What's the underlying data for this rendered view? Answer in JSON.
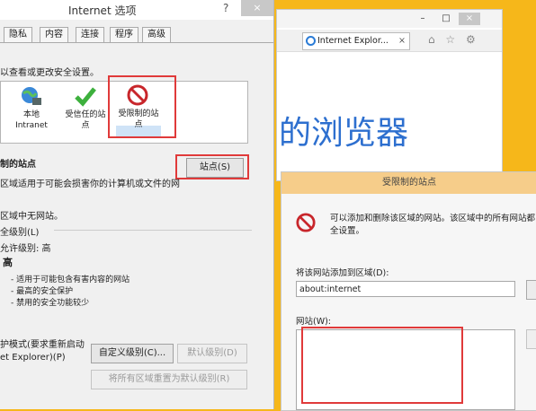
{
  "browser": {
    "tab_title": "Internet Explor...",
    "tab_close": "×",
    "minimize": "–",
    "maximize": "□",
    "close": "×",
    "nav_icons": "⌂ ☆ ⚙",
    "heading": "的浏览器"
  },
  "options_dialog": {
    "title": "Internet 选项",
    "help": "?",
    "close": "×",
    "tabs": [
      "隐私",
      "内容",
      "连接",
      "程序",
      "高级"
    ],
    "zones_desc": "以查看或更改安全设置。",
    "zones": [
      {
        "label_line1": "本地",
        "label_line2": "Intranet"
      },
      {
        "label_line1": "受信任的站",
        "label_line2": "点"
      },
      {
        "label_line1": "受限制的站",
        "label_line2": "点"
      }
    ],
    "restricted_title": "制的站点",
    "sites_button": "站点(S)",
    "restricted_desc": "区域适用于可能会损害你的计算机或文件的网",
    "no_sites": "区域中无网站。",
    "security_level_title": "全级别(L)",
    "allowed_level": "允许级别: 高",
    "level_name": "高",
    "bullets": [
      "- 适用于可能包含有害内容的网站",
      "- 最高的安全保护",
      "- 禁用的安全功能较少"
    ],
    "protect_mode_line1": "护模式(要求重新启动",
    "protect_mode_line2": "et Explorer)(P)",
    "custom_level_button": "自定义级别(C)...",
    "default_level_button": "默认级别(D)",
    "reset_all_button": "将所有区域重置为默认级别(R)"
  },
  "restricted_dialog": {
    "title": "受限制的站点",
    "info_line1": "可以添加和删除该区域的网站。该区域中的所有网站都",
    "info_line2": "全设置。",
    "add_label": "将该网站添加到区域(D):",
    "add_value": "about:internet",
    "sites_label": "网站(W):"
  }
}
